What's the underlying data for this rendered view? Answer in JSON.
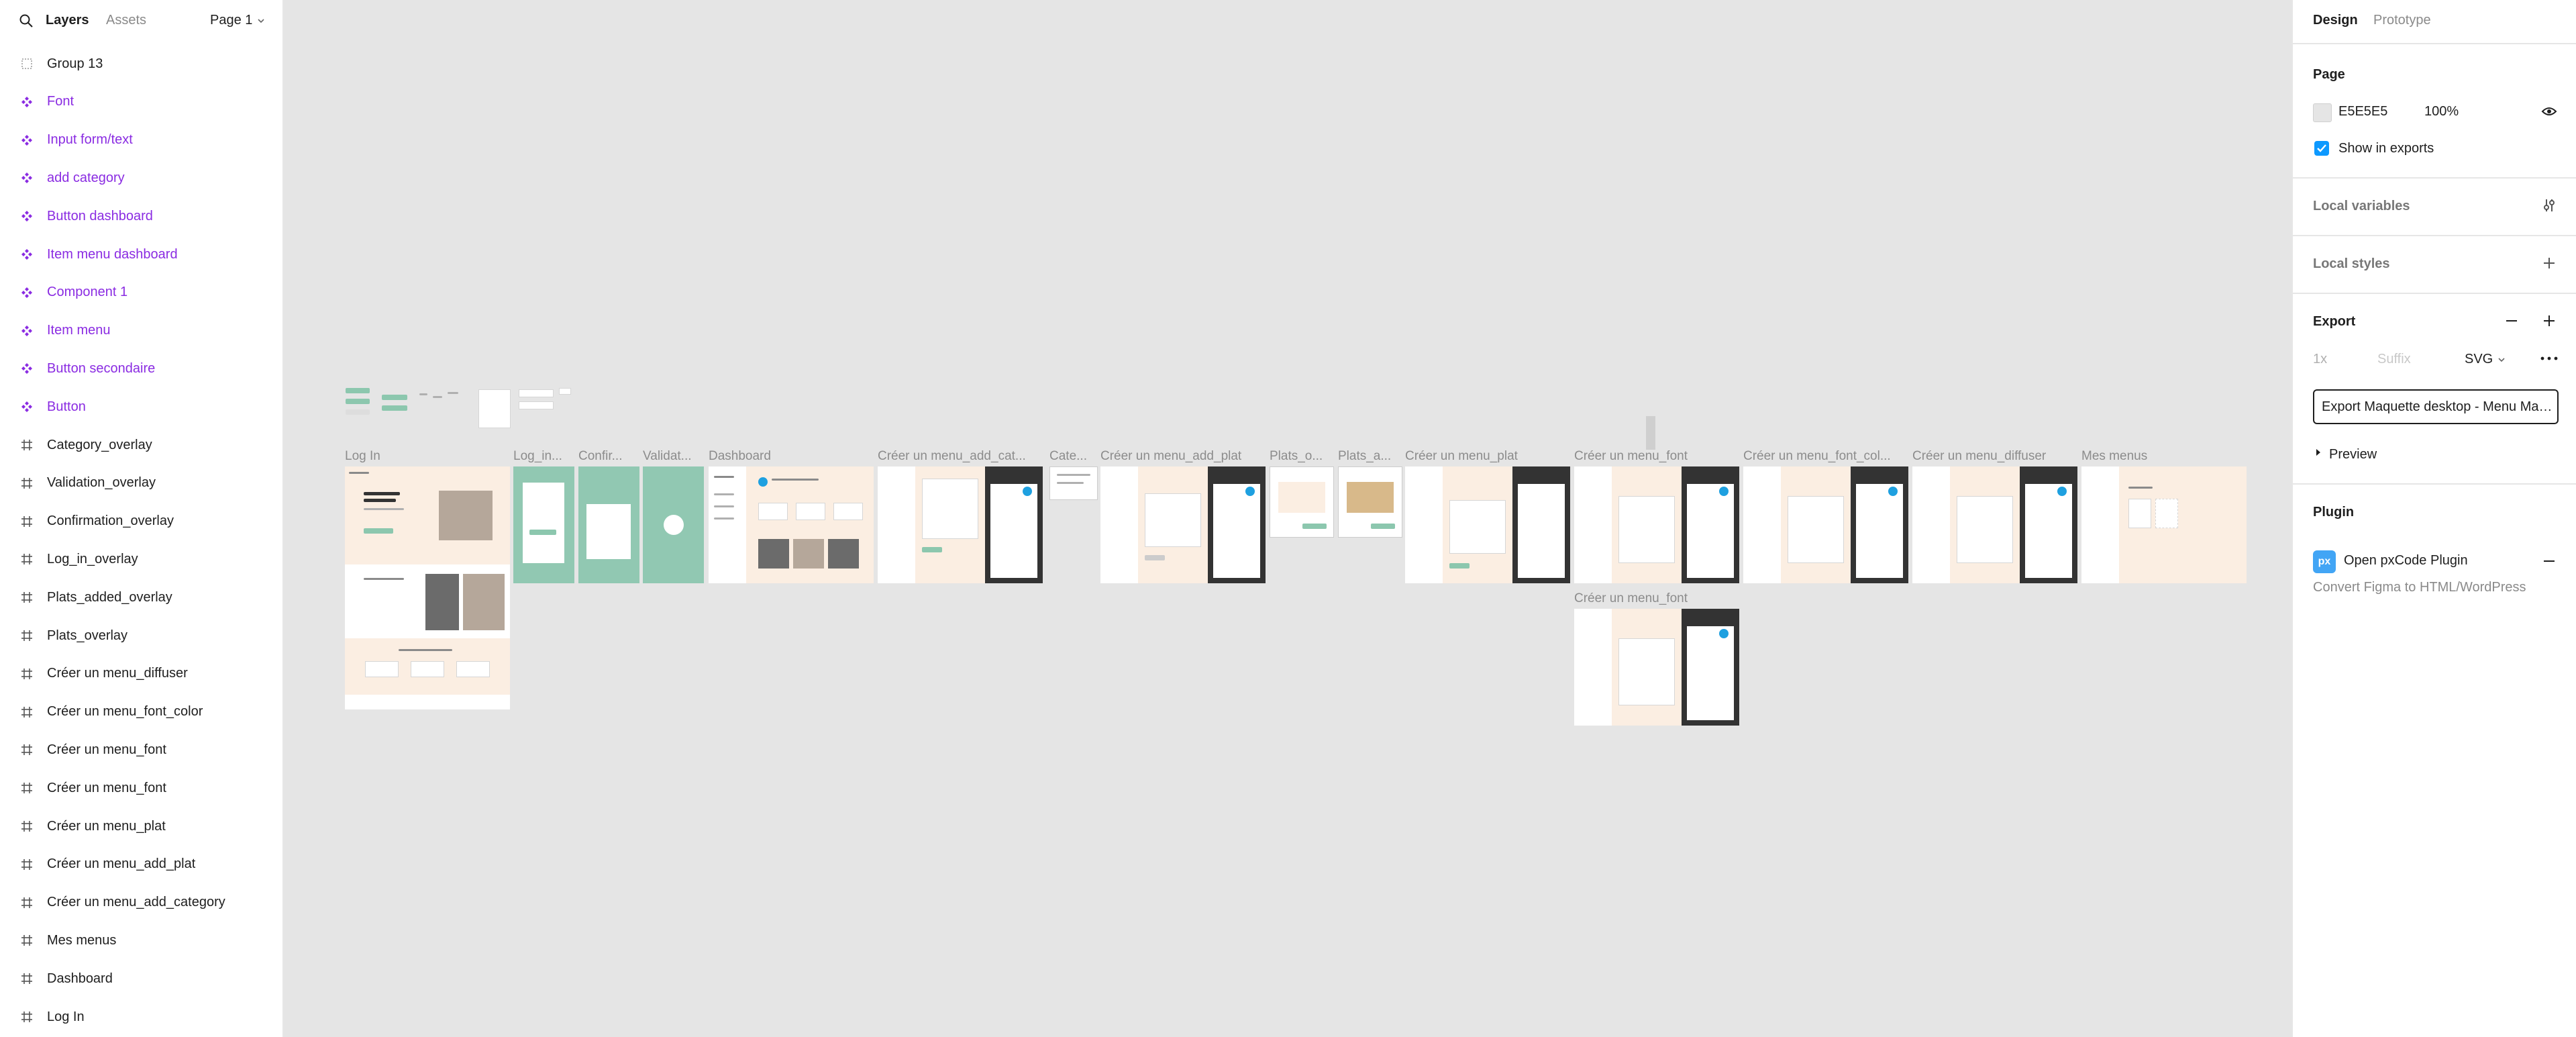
{
  "left_panel": {
    "tab_active": "Layers",
    "tab_inactive": "Assets",
    "page_selector": "Page 1",
    "layers": [
      {
        "label": "Group 13",
        "kind": "group"
      },
      {
        "label": "Font",
        "kind": "component"
      },
      {
        "label": "Input form/text",
        "kind": "component"
      },
      {
        "label": "add category",
        "kind": "component"
      },
      {
        "label": "Button dashboard",
        "kind": "component"
      },
      {
        "label": "Item menu dashboard",
        "kind": "component"
      },
      {
        "label": "Component 1",
        "kind": "component"
      },
      {
        "label": "Item menu",
        "kind": "component"
      },
      {
        "label": "Button secondaire",
        "kind": "component"
      },
      {
        "label": "Button",
        "kind": "component"
      },
      {
        "label": "Category_overlay",
        "kind": "frame"
      },
      {
        "label": "Validation_overlay",
        "kind": "frame"
      },
      {
        "label": "Confirmation_overlay",
        "kind": "frame"
      },
      {
        "label": "Log_in_overlay",
        "kind": "frame"
      },
      {
        "label": "Plats_added_overlay",
        "kind": "frame"
      },
      {
        "label": "Plats_overlay",
        "kind": "frame"
      },
      {
        "label": "Créer un menu_diffuser",
        "kind": "frame"
      },
      {
        "label": "Créer un menu_font_color",
        "kind": "frame"
      },
      {
        "label": "Créer un menu_font",
        "kind": "frame"
      },
      {
        "label": "Créer un menu_font",
        "kind": "frame"
      },
      {
        "label": "Créer un menu_plat",
        "kind": "frame"
      },
      {
        "label": "Créer un menu_add_plat",
        "kind": "frame"
      },
      {
        "label": "Créer un menu_add_category",
        "kind": "frame"
      },
      {
        "label": "Mes menus",
        "kind": "frame"
      },
      {
        "label": "Dashboard",
        "kind": "frame"
      },
      {
        "label": "Log In",
        "kind": "frame"
      }
    ]
  },
  "right_panel": {
    "tab_active": "Design",
    "tab_inactive": "Prototype",
    "page_title": "Page",
    "page_color": "E5E5E5",
    "page_opacity": "100%",
    "show_in_exports": "Show in exports",
    "local_variables": "Local variables",
    "local_styles": "Local styles",
    "export_title": "Export",
    "export_scale": "1x",
    "export_suffix_placeholder": "Suffix",
    "export_format": "SVG",
    "export_button": "Export Maquette desktop - Menu Maquette",
    "preview": "Preview",
    "plugin_title": "Plugin",
    "plugin_name": "Open pxCode Plugin",
    "plugin_icon_text": "px",
    "plugin_desc": "Convert Figma to HTML/WordPress"
  },
  "canvas": {
    "frame_labels": {
      "login": "Log In",
      "login_overlay": "Log_in...",
      "confirmation": "Confir...",
      "validation": "Validat...",
      "dashboard": "Dashboard",
      "add_category": "Créer un menu_add_cat...",
      "category_overlay": "Cate...",
      "add_plat": "Créer un menu_add_plat",
      "plats_overlay": "Plats_o...",
      "plats_added": "Plats_a...",
      "menu_plat": "Créer un menu_plat",
      "menu_font": "Créer un menu_font",
      "menu_font_color": "Créer un menu_font_col...",
      "menu_diffuser": "Créer un menu_diffuser",
      "mes_menus": "Mes menus",
      "menu_font_2": "Créer un menu_font"
    }
  },
  "colors": {
    "canvas_bg": "#e5e5e5",
    "component_purple": "#8a2be2",
    "accent_blue": "#0d99ff",
    "mint": "#91c8b2",
    "cream": "#fbeee2"
  }
}
